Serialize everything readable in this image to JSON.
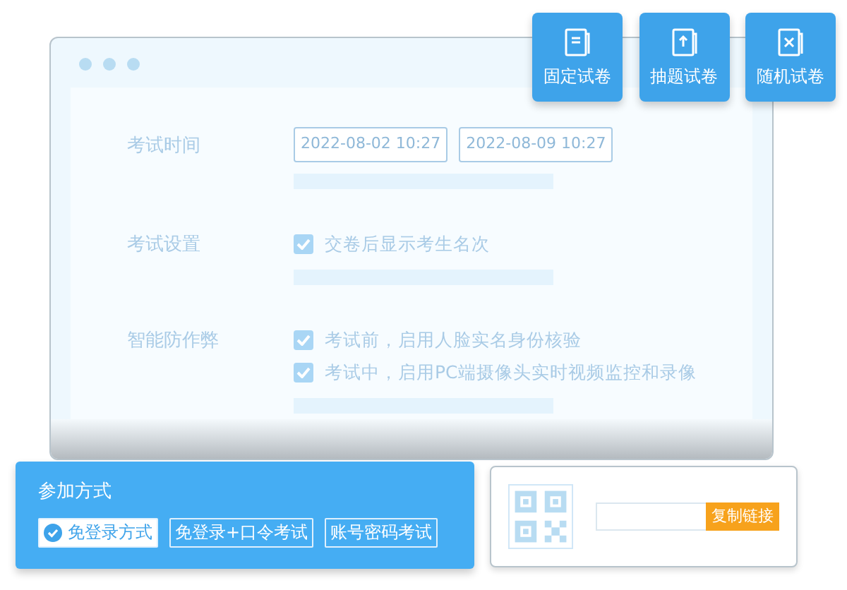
{
  "paper_types": [
    {
      "label": "固定试卷",
      "kind": "fixed"
    },
    {
      "label": "抽题试卷",
      "kind": "draw"
    },
    {
      "label": "随机试卷",
      "kind": "random"
    }
  ],
  "form": {
    "rows": [
      {
        "label": "考试时间",
        "kind": "dates",
        "values": [
          "2022-08-02 10:27",
          "2022-08-09 10:27"
        ]
      },
      {
        "label": "考试设置",
        "kind": "checks",
        "options": [
          {
            "text": "交卷后显示考生名次",
            "checked": true
          }
        ]
      },
      {
        "label": "智能防作弊",
        "kind": "checks",
        "options": [
          {
            "text": "考试前，启用人脸实名身份核验",
            "checked": true
          },
          {
            "text": "考试中，启用PC端摄像头实时视频监控和录像",
            "checked": true
          }
        ]
      }
    ]
  },
  "join": {
    "title": "参加方式",
    "options": [
      {
        "label": "免登录方式",
        "selected": true
      },
      {
        "label": "免登录+口令考试",
        "selected": false
      },
      {
        "label": "账号密码考试",
        "selected": false
      }
    ]
  },
  "share": {
    "button": "复制链接"
  }
}
